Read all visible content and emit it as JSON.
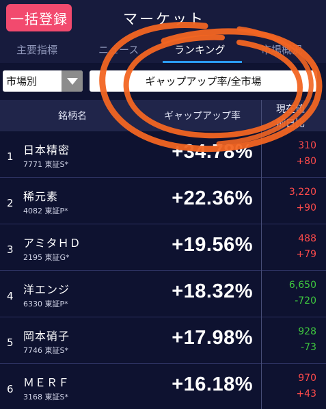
{
  "header": {
    "bulk_register_label": "一括登録",
    "title": "マーケット"
  },
  "tabs": [
    {
      "label": "主要指標",
      "active": false
    },
    {
      "label": "ニュース",
      "active": false
    },
    {
      "label": "ランキング",
      "active": true
    },
    {
      "label": "市場概況",
      "active": false
    }
  ],
  "filters": {
    "market_select_value": "市場別",
    "ranking_type_value": "ギャップアップ率/全市場"
  },
  "table": {
    "columns": {
      "name": "銘柄名",
      "gap_rate": "ギャップアップ率",
      "price_line1": "現在値",
      "price_line2": "前日比"
    },
    "rows": [
      {
        "rank": "1",
        "name": "日本精密",
        "code": "7771 東証S*",
        "rate": "+34.78%",
        "price": "310",
        "change": "+80",
        "color": "#ff4b4b"
      },
      {
        "rank": "2",
        "name": "稀元素",
        "code": "4082 東証P*",
        "rate": "+22.36%",
        "price": "3,220",
        "change": "+90",
        "color": "#ff4b4b"
      },
      {
        "rank": "3",
        "name": "アミタＨＤ",
        "code": "2195 東証G*",
        "rate": "+19.56%",
        "price": "488",
        "change": "+79",
        "color": "#ff4b4b"
      },
      {
        "rank": "4",
        "name": "洋エンジ",
        "code": "6330 東証P*",
        "rate": "+18.32%",
        "price": "6,650",
        "change": "-720",
        "color": "#3fc83f"
      },
      {
        "rank": "5",
        "name": "岡本硝子",
        "code": "7746 東証S*",
        "rate": "+17.98%",
        "price": "928",
        "change": "-73",
        "color": "#3fc83f"
      },
      {
        "rank": "6",
        "name": "ＭＥＲＦ",
        "code": "3168 東証S*",
        "rate": "+16.18%",
        "price": "970",
        "change": "+43",
        "color": "#ff4b4b"
      }
    ]
  },
  "colors": {
    "up": "#ff4b4b",
    "down": "#3fc83f",
    "accent": "#2b9cf2",
    "annotation": "#f26522"
  }
}
